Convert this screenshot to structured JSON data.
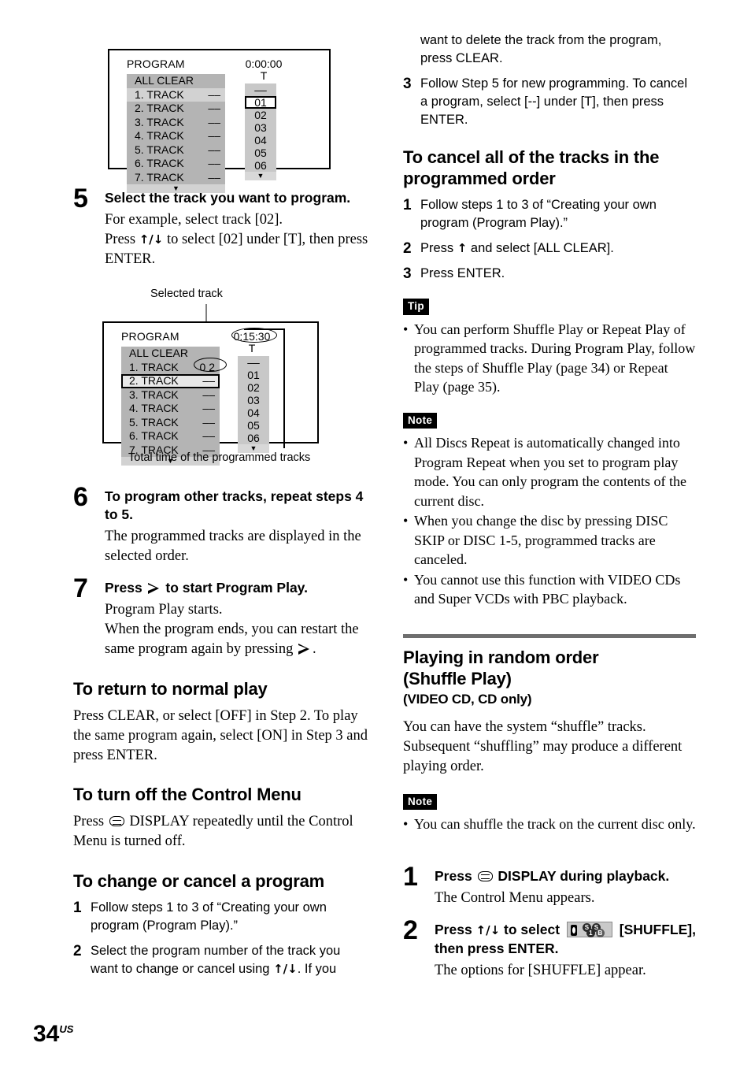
{
  "page": {
    "folio_number": "34",
    "folio_suffix": "US"
  },
  "osd_top": {
    "title": "PROGRAM",
    "time": "0:00:00",
    "t_label": "T",
    "all_clear": "ALL CLEAR",
    "rows": [
      {
        "label": "1. TRACK",
        "value": "––"
      },
      {
        "label": "2. TRACK",
        "value": "––"
      },
      {
        "label": "3. TRACK",
        "value": "––"
      },
      {
        "label": "4. TRACK",
        "value": "––"
      },
      {
        "label": "5. TRACK",
        "value": "––"
      },
      {
        "label": "6. TRACK",
        "value": "––"
      },
      {
        "label": "7. TRACK",
        "value": "––"
      }
    ],
    "numbers": [
      "––",
      "01",
      "02",
      "03",
      "04",
      "05",
      "06"
    ],
    "selected_number": "01",
    "scroll_glyph": "▼"
  },
  "osd_bottom": {
    "callout_top": "Selected track",
    "callout_bottom": "Total time of the programmed tracks",
    "title": "PROGRAM",
    "time": "0:15:30",
    "t_label": "T",
    "all_clear": "ALL CLEAR",
    "rows": [
      {
        "label": "1. TRACK",
        "value": "0 2"
      },
      {
        "label": "2. TRACK",
        "value": "––"
      },
      {
        "label": "3. TRACK",
        "value": "––"
      },
      {
        "label": "4. TRACK",
        "value": "––"
      },
      {
        "label": "5. TRACK",
        "value": "––"
      },
      {
        "label": "6. TRACK",
        "value": "––"
      },
      {
        "label": "7. TRACK",
        "value": "––"
      }
    ],
    "numbers": [
      "––",
      "01",
      "02",
      "03",
      "04",
      "05",
      "06"
    ],
    "boxed_row_index": 1,
    "scroll_glyph": "▼"
  },
  "left": {
    "step5": {
      "num": "5",
      "head": "Select the track you want to program.",
      "line1": "For example, select track [02].",
      "line2_a": "Press ",
      "line2_arrows": "↑/↓",
      "line2_b": " to select [02] under [T], then press ENTER."
    },
    "step6": {
      "num": "6",
      "head": "To program other tracks, repeat steps 4 to 5.",
      "sub": "The programmed tracks are displayed in the selected order."
    },
    "step7": {
      "num": "7",
      "head_a": "Press ",
      "head_b": " to start Program Play.",
      "sub_line1": "Program Play starts.",
      "sub_line2_a": "When the program ends, you can restart the same program again by pressing ",
      "sub_line2_b": "."
    },
    "h_return": "To return to normal play",
    "p_return": "Press CLEAR, or select [OFF] in Step 2. To play the same program again, select [ON] in Step 3 and press ENTER.",
    "h_turnoff": "To turn off the Control Menu",
    "p_turnoff_a": "Press ",
    "p_turnoff_b": " DISPLAY repeatedly until the Control Menu is turned off.",
    "h_change": "To change or cancel a program",
    "change_steps": [
      {
        "num": "1",
        "text": "Follow steps 1 to 3 of “Creating your own program (Program Play).”"
      },
      {
        "num": "2",
        "text_a": "Select the program number of the track you want to change or cancel using ",
        "arrows": "↑/↓",
        "text_b": ". If you"
      }
    ]
  },
  "right": {
    "cont_text": "want to delete the track from the program, press CLEAR.",
    "step3": {
      "num": "3",
      "text": "Follow Step 5 for new programming. To cancel a program, select [--] under [T], then press ENTER."
    },
    "h_cancel_all": "To cancel all of the tracks in the programmed order",
    "cancel_steps": [
      {
        "num": "1",
        "text": "Follow steps 1 to 3 of “Creating your own program (Program Play).”"
      },
      {
        "num": "2",
        "text_a": "Press ",
        "arrows": "↑",
        "text_b": " and select [ALL CLEAR]."
      },
      {
        "num": "3",
        "text": "Press ENTER."
      }
    ],
    "tip_badge": "Tip",
    "tip_bullets": [
      "You can perform Shuffle Play or Repeat Play of programmed tracks. During Program Play, follow the steps of Shuffle Play (page 34) or Repeat Play (page 35)."
    ],
    "note_badge_1": "Note",
    "note_bullets_1": [
      "All Discs Repeat is automatically changed into Program Repeat when you set to program play mode. You can only program the contents of the current disc.",
      "When you change the disc by pressing DISC SKIP or DISC 1-5, programmed tracks are canceled.",
      "You cannot use this function with VIDEO CDs and Super VCDs with PBC playback."
    ],
    "section_title_line1": "Playing in random order",
    "section_title_line2": "(Shuffle Play)",
    "section_subtitle": "(VIDEO CD, CD only)",
    "section_intro": "You can have the system “shuffle” tracks. Subsequent “shuffling” may produce a different playing order.",
    "note_badge_2": "Note",
    "note_bullets_2": [
      "You can shuffle the track on the current disc only."
    ],
    "step1": {
      "num": "1",
      "head_a": "Press ",
      "head_b": " DISPLAY during playback.",
      "sub": "The Control Menu appears."
    },
    "step2": {
      "num": "2",
      "head_a": "Press ",
      "head_arrows": "↑/↓",
      "head_b": " to select ",
      "head_c": " [SHUFFLE], then press ENTER.",
      "sub": "The options for [SHUFFLE] appear.",
      "icon_balls": [
        "S",
        "S",
        "1",
        "B"
      ]
    }
  }
}
